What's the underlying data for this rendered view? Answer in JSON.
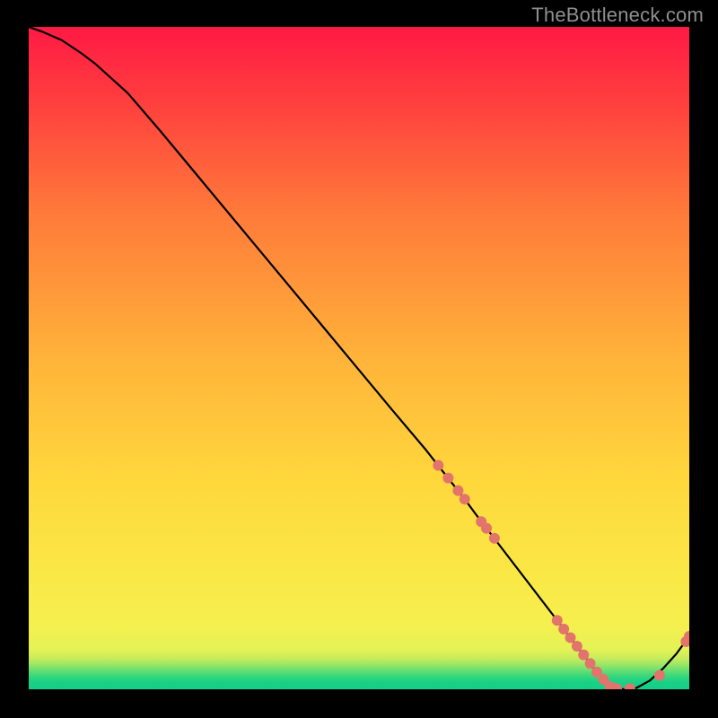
{
  "watermark": "TheBottleneck.com",
  "chart_data": {
    "type": "line",
    "title": "",
    "xlabel": "",
    "ylabel": "",
    "xlim": [
      0,
      100
    ],
    "ylim": [
      0,
      100
    ],
    "grid": false,
    "legend": false,
    "background_gradient": {
      "top_color": "#ff1a44",
      "mid_colors": [
        "#ff7a3a",
        "#ffd43b",
        "#f8ee4a"
      ],
      "green_band": "#25e07a",
      "bottom_stripes": [
        "#d8f760",
        "#8de26b",
        "#33d87c",
        "#17cf86",
        "#17cf86"
      ]
    },
    "curve": {
      "description": "Bottleneck curve: starts at top-left (100% mismatch), falls steeply toward the right, reaches zero near x≈88 then rises slightly.",
      "x": [
        0,
        2,
        5,
        8,
        10,
        15,
        20,
        25,
        30,
        35,
        40,
        45,
        50,
        55,
        60,
        63,
        66,
        68,
        70,
        72,
        74,
        76,
        78,
        80,
        82,
        84,
        86,
        88,
        90,
        92,
        94,
        96,
        98,
        100
      ],
      "y": [
        100,
        99.3,
        98,
        96,
        94.5,
        90,
        84.2,
        78.2,
        72.2,
        66.2,
        60.2,
        54.2,
        48.2,
        42.2,
        36.3,
        32.5,
        28.7,
        26,
        23.4,
        20.8,
        18.2,
        15.6,
        13,
        10.4,
        7.8,
        5.2,
        2.6,
        0.4,
        0,
        0.2,
        1.3,
        3.1,
        5.3,
        8
      ]
    },
    "markers": {
      "description": "Coral dotted markers along the lower-right portion of the curve indicating measured data points.",
      "color": "#e3746b",
      "radius": 6,
      "points": [
        {
          "x": 62,
          "y": 33.8
        },
        {
          "x": 63.5,
          "y": 31.9
        },
        {
          "x": 65,
          "y": 30
        },
        {
          "x": 66,
          "y": 28.7
        },
        {
          "x": 68.5,
          "y": 25.3
        },
        {
          "x": 69.3,
          "y": 24.3
        },
        {
          "x": 70.5,
          "y": 22.8
        },
        {
          "x": 80,
          "y": 10.4
        },
        {
          "x": 81,
          "y": 9.1
        },
        {
          "x": 82,
          "y": 7.8
        },
        {
          "x": 83,
          "y": 6.5
        },
        {
          "x": 84,
          "y": 5.2
        },
        {
          "x": 85,
          "y": 3.9
        },
        {
          "x": 86,
          "y": 2.6
        },
        {
          "x": 87,
          "y": 1.5
        },
        {
          "x": 88,
          "y": 0.4
        },
        {
          "x": 89,
          "y": 0.1
        },
        {
          "x": 91,
          "y": 0.1
        },
        {
          "x": 95.5,
          "y": 2.1
        },
        {
          "x": 99.5,
          "y": 7.2
        },
        {
          "x": 100,
          "y": 8
        }
      ]
    }
  }
}
